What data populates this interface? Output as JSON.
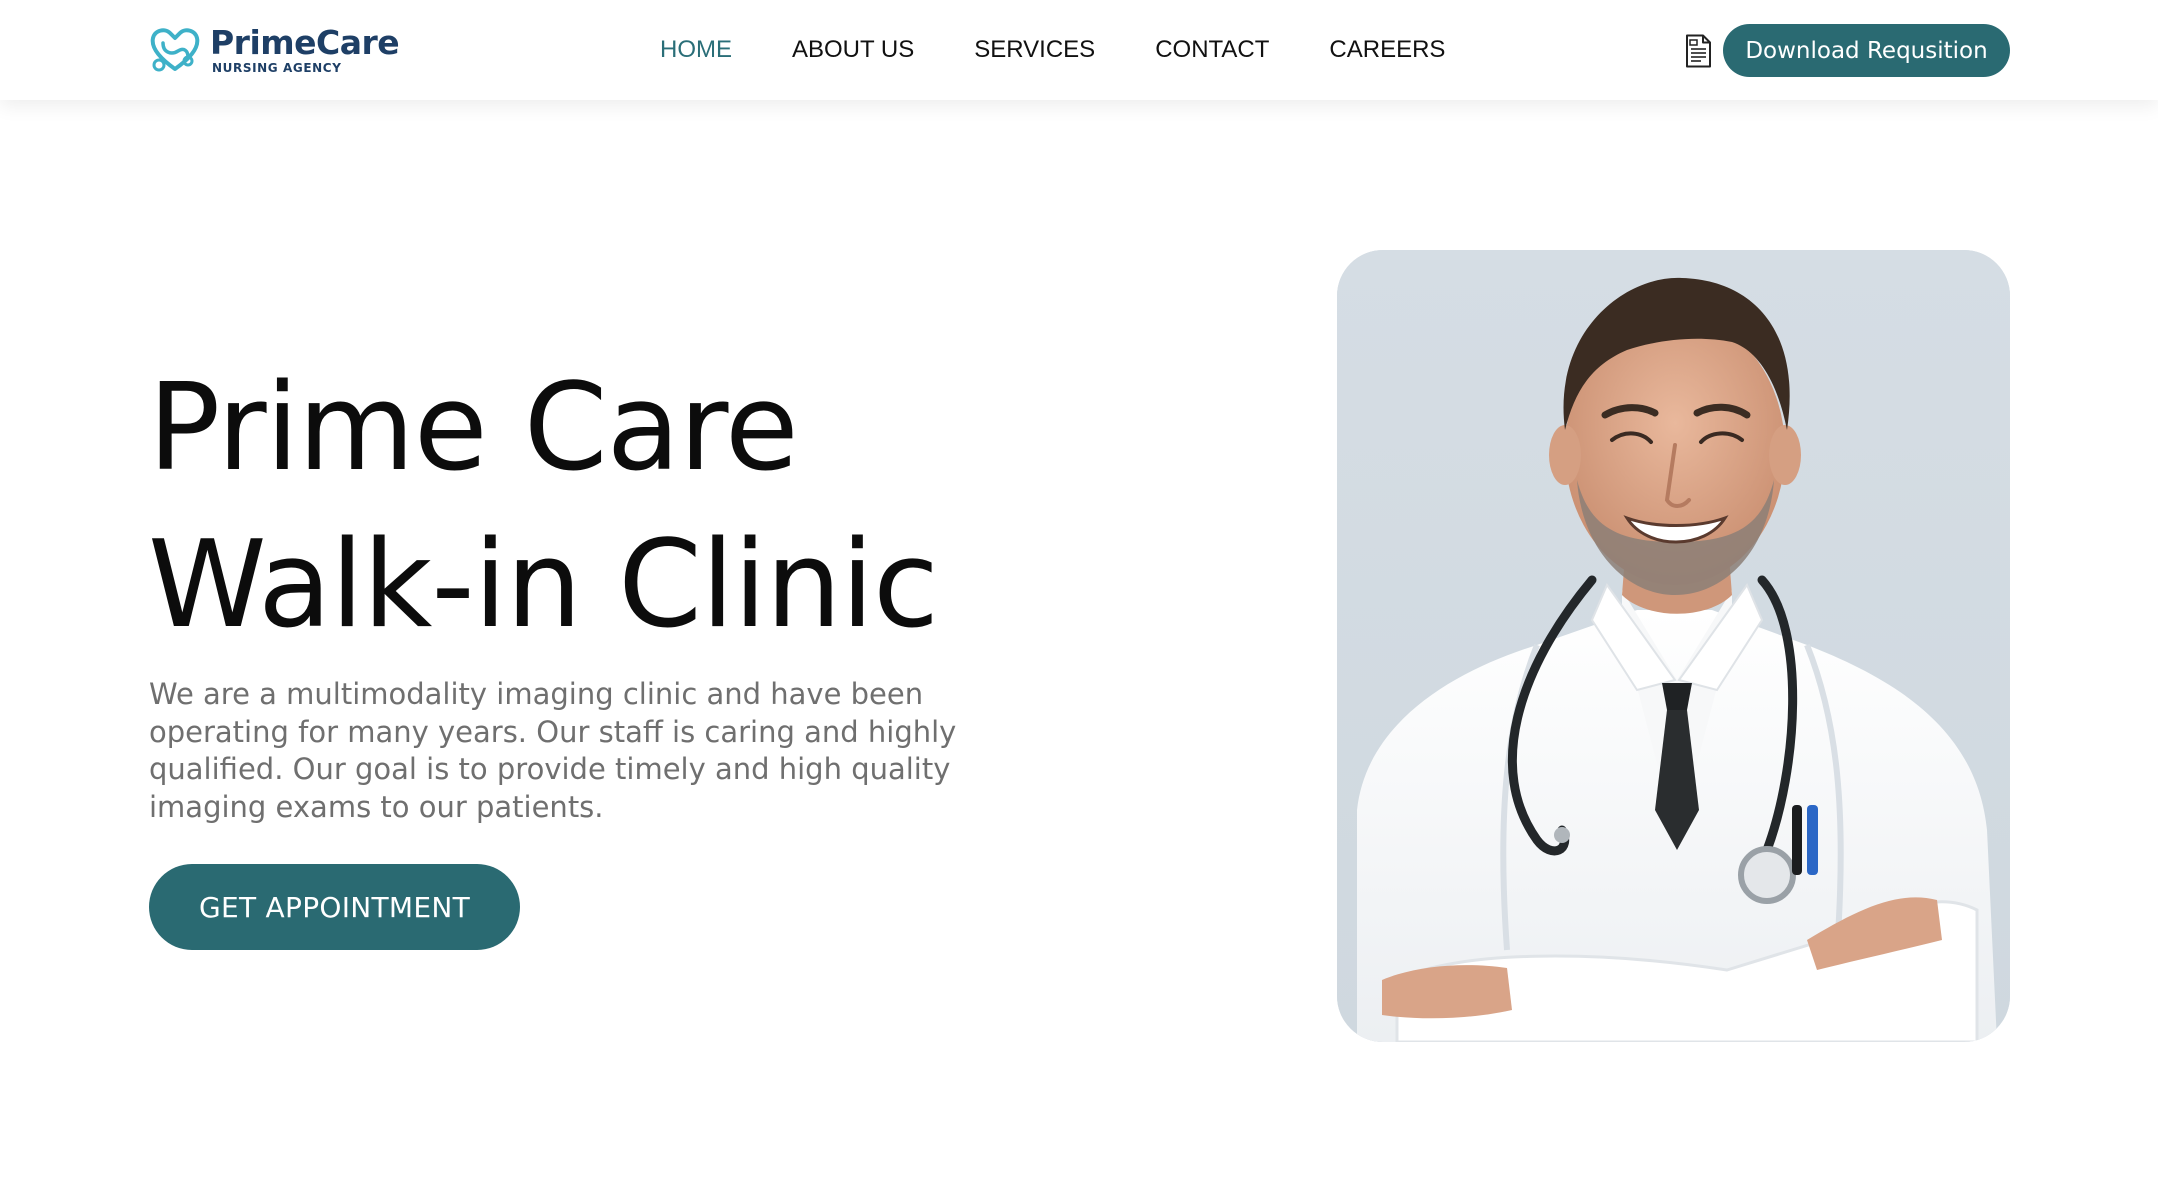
{
  "brand": {
    "name": "PrimeCare",
    "subtitle": "NURSING AGENCY",
    "accent_color": "#2a6a72",
    "logo_icon": "heart-stethoscope-icon"
  },
  "nav": {
    "items": [
      {
        "label": "HOME",
        "active": true
      },
      {
        "label": "ABOUT US",
        "active": false
      },
      {
        "label": "SERVICES",
        "active": false
      },
      {
        "label": "CONTACT",
        "active": false
      },
      {
        "label": "CAREERS",
        "active": false
      }
    ]
  },
  "header": {
    "document_icon": "document-icon",
    "download_label": "Download Requsition"
  },
  "hero": {
    "title_line1": "Prime Care",
    "title_line2": "Walk-in Clinic",
    "description": "We are a multimodality imaging clinic and have been operating for many years. Our staff is caring and highly qualified. Our goal is to provide timely and high quality imaging exams to our patients.",
    "cta_label": "GET APPOINTMENT",
    "image": "smiling-doctor-photo"
  }
}
